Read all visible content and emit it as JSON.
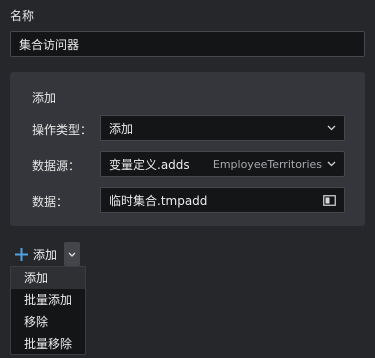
{
  "name_section": {
    "label": "名称",
    "value": "集合访问器"
  },
  "add_panel": {
    "title": "添加",
    "operation_type": {
      "label": "操作类型：",
      "value": "添加"
    },
    "data_source": {
      "label": "数据源：",
      "value": "变量定义.adds",
      "secondary": "EmployeeTerritories"
    },
    "data": {
      "label": "数据：",
      "value": "临时集合.tmpadd"
    }
  },
  "add_button": {
    "label": "添加",
    "icon": "plus-icon",
    "accent": "#4ea1e6"
  },
  "dropdown_menu": {
    "items": [
      "添加",
      "批量添加",
      "移除",
      "批量移除"
    ],
    "selected": "添加"
  }
}
